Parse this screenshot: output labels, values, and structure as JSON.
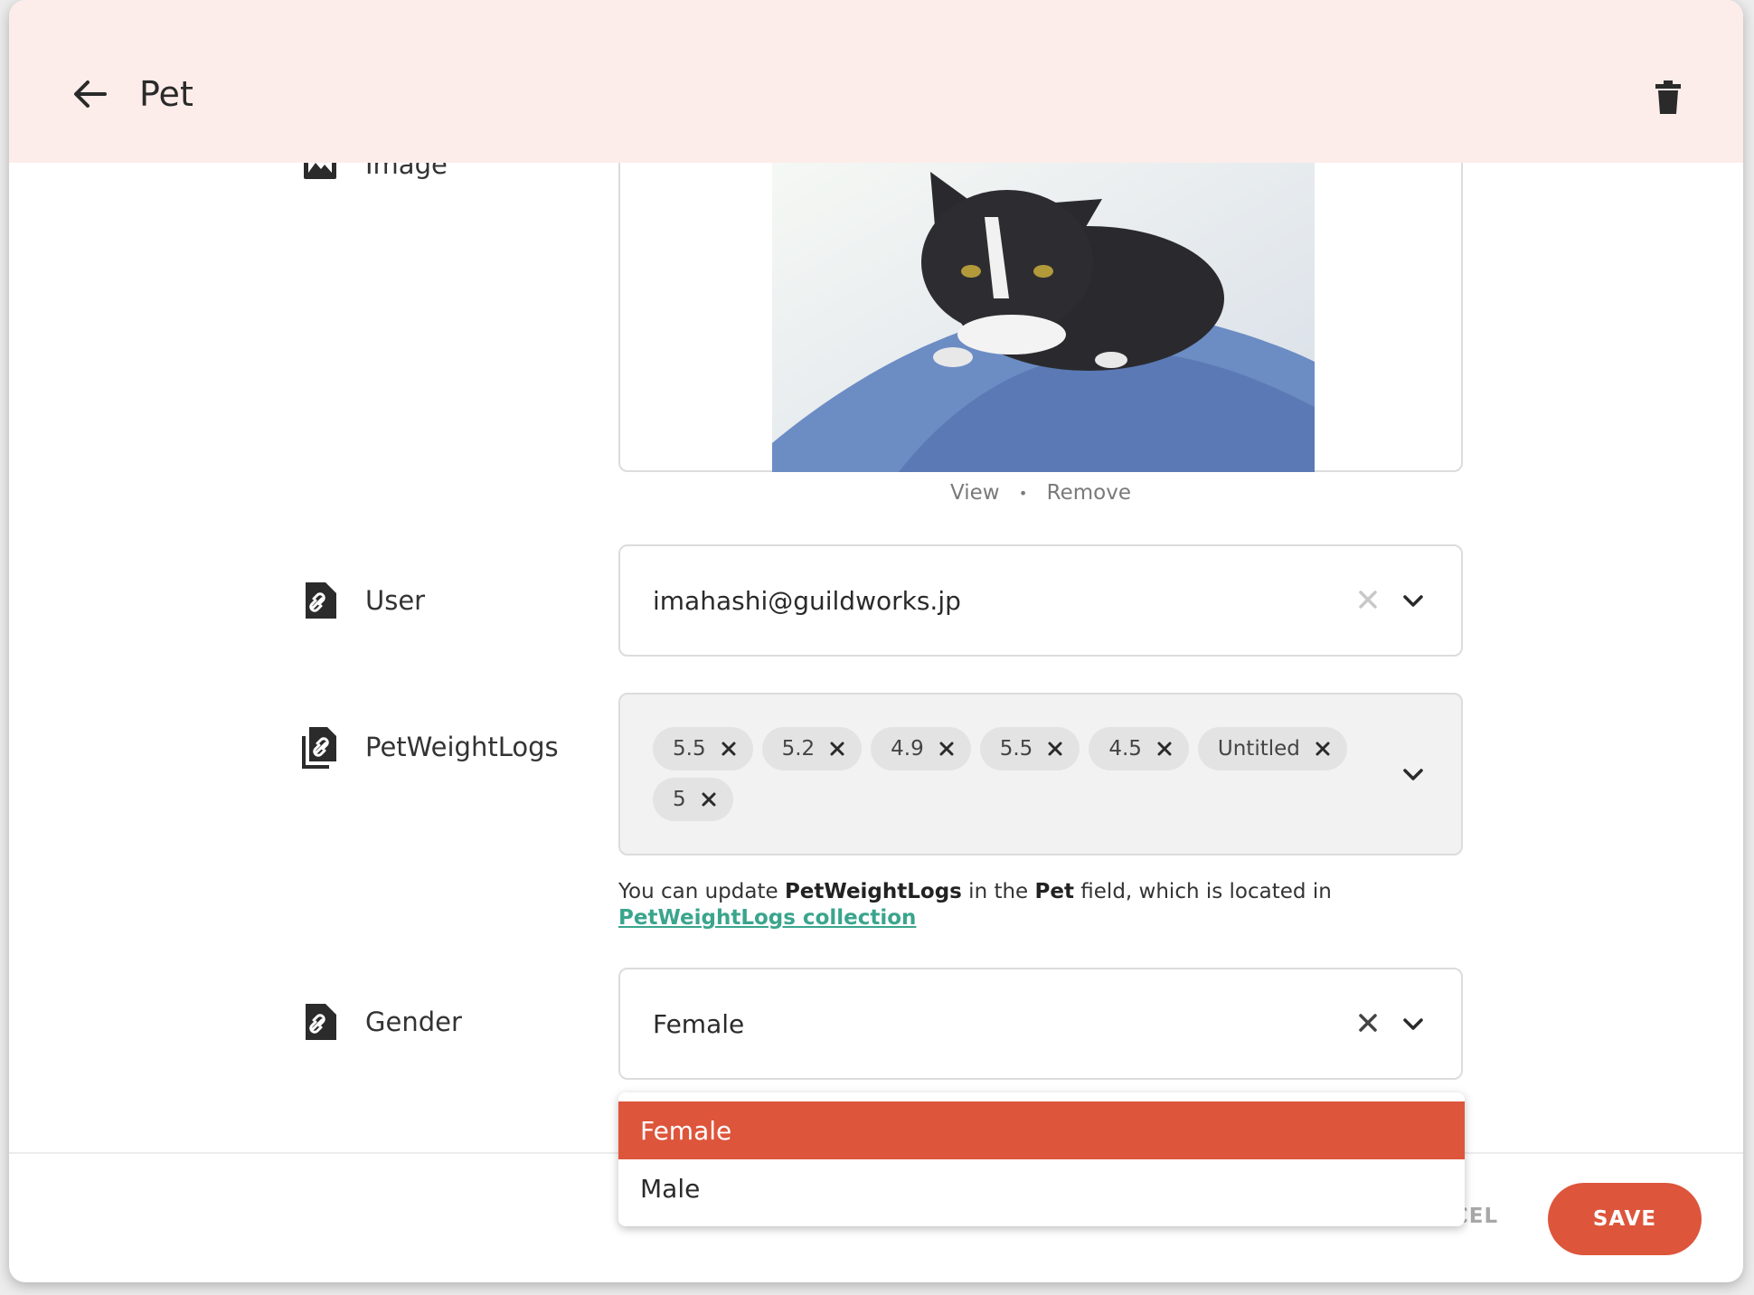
{
  "header": {
    "title": "Pet"
  },
  "fields": {
    "image": {
      "label": "Image",
      "view_label": "View",
      "separator": "•",
      "remove_label": "Remove"
    },
    "user": {
      "label": "User",
      "value": "imahashi@guildworks.jp"
    },
    "petweightlogs": {
      "label": "PetWeightLogs",
      "chips": [
        "5.5",
        "5.2",
        "4.9",
        "5.5",
        "4.5",
        "Untitled",
        "5"
      ]
    },
    "gender": {
      "label": "Gender",
      "value": "Female",
      "options": [
        "Female",
        "Male"
      ]
    }
  },
  "helper": {
    "prefix": "You can update ",
    "field_name": "PetWeightLogs",
    "middle": " in the ",
    "target_field": "Pet",
    "suffix": " field, which is located in",
    "link_text": "PetWeightLogs collection"
  },
  "footer": {
    "cancel_label": "CANCEL",
    "save_label": "SAVE"
  },
  "colors": {
    "accent": "#dd553b",
    "header_bg": "#fcedea",
    "link": "#3aa58d"
  }
}
